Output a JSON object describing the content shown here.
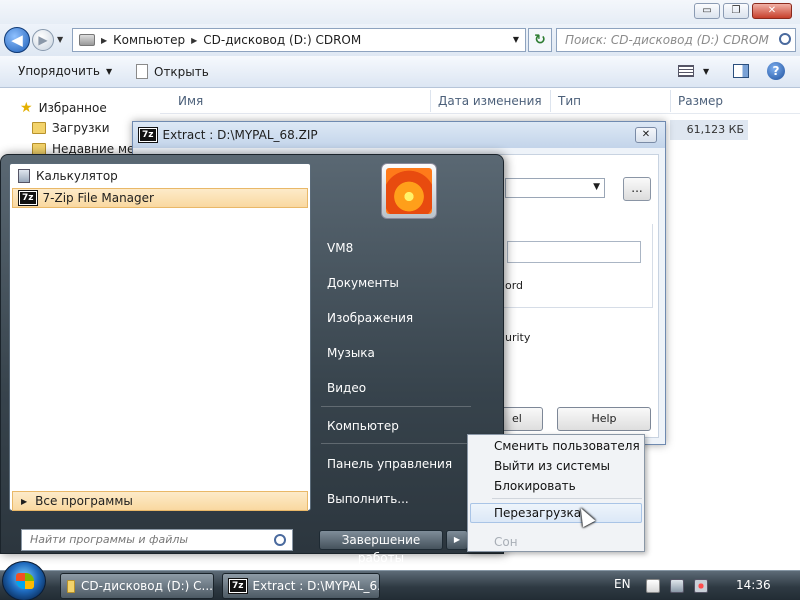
{
  "explorer": {
    "window_buttons": {
      "minimize": "▭",
      "maximize": "❐",
      "close": "✕"
    },
    "nav": {
      "back": "◀",
      "forward": "▶",
      "history": "▼"
    },
    "breadcrumb": [
      "Компьютер",
      "CD-дисковод (D:) CDROM"
    ],
    "breadcrumb_sep": "▶",
    "addr_dropdown": "▼",
    "refresh": "↻",
    "search_placeholder": "Поиск: CD-дисковод (D:) CDROM",
    "toolbar": {
      "organize": "Упорядочить",
      "organize_arrow": "▼",
      "open": "Открыть",
      "view_arrow": "▼",
      "help": "?"
    },
    "nav_pane": {
      "favorites": "Избранное",
      "downloads": "Загрузки",
      "recent": "Недавние мест"
    },
    "columns": {
      "name": "Имя",
      "date": "Дата изменения",
      "type": "Тип",
      "size": "Размер"
    },
    "file_size": "61,123 КБ"
  },
  "dialog": {
    "title": "Extract : D:\\MYPAL_68.ZIP",
    "logo": "7z",
    "close": "✕",
    "browse_label": "...",
    "combo_arrow": "▼",
    "partial_text_1": "ord",
    "partial_text_2": "urity",
    "cancel_partial": "el",
    "help": "Help"
  },
  "start_menu": {
    "programs": [
      {
        "label": "Калькулятор"
      },
      {
        "label": "7-Zip File Manager",
        "logo": "7z"
      }
    ],
    "all_programs": "Все программы",
    "all_programs_arrow": "▶",
    "search_placeholder": "Найти программы и файлы",
    "right_items": {
      "user": "VM8",
      "documents": "Документы",
      "pictures": "Изображения",
      "music": "Музыка",
      "video": "Видео",
      "computer": "Компьютер",
      "control_panel": "Панель управления",
      "run": "Выполнить..."
    },
    "shutdown": "Завершение работы",
    "shutdown_arrow": "▶"
  },
  "shutdown_submenu": {
    "items": [
      "Сменить пользователя",
      "Выйти из системы",
      "Блокировать",
      "Перезагрузка",
      "Сон"
    ],
    "highlighted": "Перезагрузка",
    "disabled": "Сон"
  },
  "taskbar": {
    "buttons": [
      "CD-дисковод (D:) C...",
      "Extract : D:\\MYPAL_6..."
    ],
    "logo": "7z",
    "lang": "EN",
    "time": "14:36"
  }
}
